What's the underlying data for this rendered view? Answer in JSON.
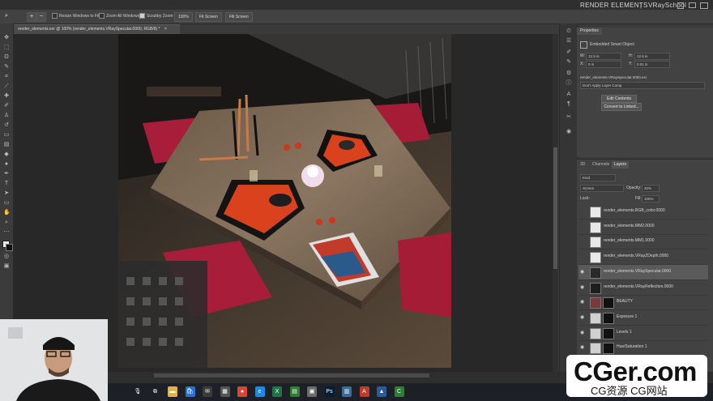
{
  "titlebar": {
    "title": "RENDER ELEMENTS",
    "separator": "|",
    "brand": "VRaySchool"
  },
  "optionsbar": {
    "resize_windows": "Resize Windows to Fit",
    "zoom_all": "Zoom All Windows",
    "scrubby_zoom": "Scrubby Zoom",
    "zoom_value": "100%",
    "fit_screen": "Fit Screen",
    "fill_screen": "Fill Screen"
  },
  "document": {
    "tab_label": "render_elements.exr @ 100% (render_elements.VRaySpecular.0000, RGB/8) *",
    "close": "×"
  },
  "properties": {
    "tab": "Properties",
    "header": "Embedded Smart Object",
    "w_label": "W:",
    "w_value": "12.5 in",
    "h_label": "H:",
    "h_value": "12.5 in",
    "x_label": "X:",
    "x_value": "0 in",
    "y_label": "Y:",
    "y_value": "0.01 in",
    "file": "render_elements.VRaySpecular.0000.exr",
    "layer_comp": "Don't Apply Layer Comp",
    "edit_contents": "Edit Contents",
    "convert_linked": "Convert to Linked..."
  },
  "layers_panel": {
    "tabs": [
      "3D",
      "Channels",
      "Layers"
    ],
    "kind": "Kind",
    "blend_mode": "Screen",
    "opacity_label": "Opacity:",
    "opacity_value": "20%",
    "lock_label": "Lock:",
    "fill_label": "Fill:",
    "fill_value": "100%",
    "layers": [
      {
        "name": "render_elements.RGB_color.0000",
        "visible": false,
        "selected": false
      },
      {
        "name": "render_elements.MM2.0000",
        "visible": false,
        "selected": false
      },
      {
        "name": "render_elements.MM1.0000",
        "visible": false,
        "selected": false
      },
      {
        "name": "render_elements.VRayZDepth.0000",
        "visible": false,
        "selected": false
      },
      {
        "name": "render_elements.VRaySpecular.0000",
        "visible": true,
        "selected": true
      },
      {
        "name": "render_elements.VRayReflection.0000",
        "visible": true,
        "selected": false
      },
      {
        "name": "BEAUTY",
        "visible": true,
        "selected": false
      },
      {
        "name": "Exposure 1",
        "visible": true,
        "selected": false
      },
      {
        "name": "Levels 1",
        "visible": true,
        "selected": false
      },
      {
        "name": "Hue/Saturation 1",
        "visible": true,
        "selected": false
      }
    ]
  },
  "watermark": {
    "line1": "CGer.com",
    "line2": "CG资源 CG网站"
  },
  "taskbar_icons": [
    "mic-icon",
    "task-view-icon",
    "file-explorer-icon",
    "store-icon",
    "mail-icon",
    "calculator-icon",
    "chrome-icon",
    "edge-icon",
    "excel-icon",
    "app-icon",
    "app-icon-2",
    "photoshop-icon",
    "app-icon-3",
    "acrobat-icon",
    "photos-icon",
    "camtasia-icon"
  ],
  "colors": {
    "ps_panel": "#424242",
    "ps_dark": "#282828",
    "accent_cushion": "#b81e3c",
    "plate_orange": "#d9421c"
  }
}
